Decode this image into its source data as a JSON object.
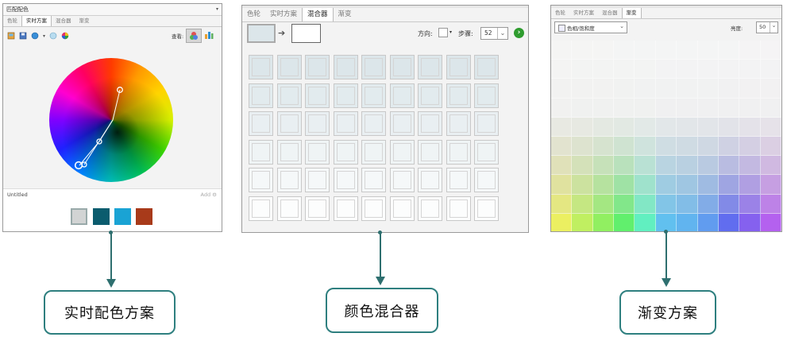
{
  "panel1": {
    "title": "匹配配色",
    "dropdown_glyph": "▾",
    "tabs": [
      "色轮",
      "实时方案",
      "混合器",
      "渐变"
    ],
    "active_tab": 1,
    "toolbar_label": "查看:",
    "untitled": "Untitled",
    "add": "Add",
    "swatches": [
      "#d2d4d4",
      "#0b5c6e",
      "#1aa3d4",
      "#a83a1a"
    ]
  },
  "panel2": {
    "tabs": [
      "色轮",
      "实时方案",
      "混合器",
      "渐变"
    ],
    "active_tab": 2,
    "direction_label": "方向:",
    "steps_label": "步骤:",
    "steps_value": "52",
    "from_color": "#dce6ea",
    "to_color": "#ffffff",
    "go_color": "#2f9c2f"
  },
  "panel3": {
    "tabs": [
      "色轮",
      "实时方案",
      "混合器",
      "渐变"
    ],
    "active_tab": 3,
    "select_value": "色相/饱和度",
    "brightness_label": "亮度:",
    "brightness_value": "50"
  },
  "labels": {
    "label1": "实时配色方案",
    "label2": "颜色混合器",
    "label3": "渐变方案"
  }
}
